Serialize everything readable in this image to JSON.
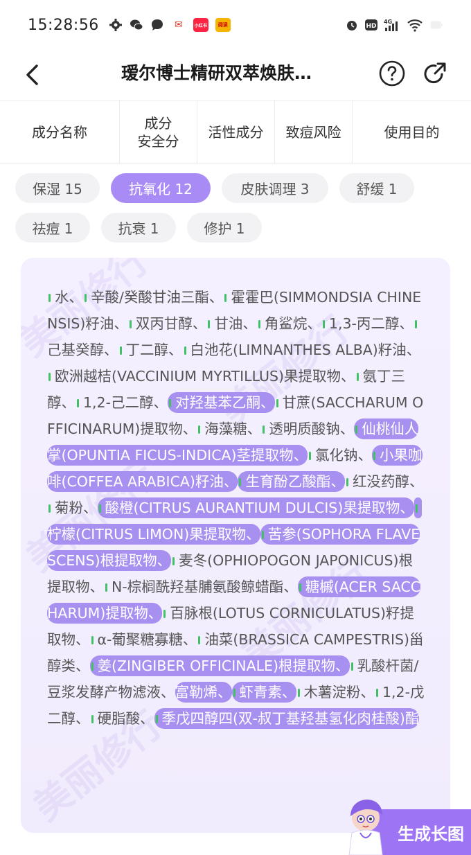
{
  "status": {
    "time": "15:28:56",
    "app_badge_1": "小红书",
    "app_badge_2": "阅读"
  },
  "nav": {
    "title": "瑷尔博士精研双萃焕肤…"
  },
  "columns": [
    {
      "label": "成分名称"
    },
    {
      "label": "成分\n安全分"
    },
    {
      "label": "活性成分"
    },
    {
      "label": "致痘风险"
    },
    {
      "label": "使用目的"
    }
  ],
  "chips": [
    {
      "label": "保湿 15",
      "active": false
    },
    {
      "label": "抗氧化 12",
      "active": true
    },
    {
      "label": "皮肤调理 3",
      "active": false
    },
    {
      "label": "舒缓 1",
      "active": false
    },
    {
      "label": "祛痘 1",
      "active": false
    },
    {
      "label": "抗衰 1",
      "active": false
    },
    {
      "label": "修护 1",
      "active": false
    }
  ],
  "watermark": "美丽修行",
  "ingredients": [
    {
      "name": "水",
      "hl": false
    },
    {
      "name": "辛酸/癸酸甘油三酯",
      "hl": false
    },
    {
      "name": "霍霍巴(SIMMONDSIA CHINENSIS)籽油",
      "hl": false
    },
    {
      "name": "双丙甘醇",
      "hl": false
    },
    {
      "name": "甘油",
      "hl": false
    },
    {
      "name": "角鲨烷",
      "hl": false
    },
    {
      "name": "1,3-丙二醇",
      "hl": false
    },
    {
      "name": "己基癸醇",
      "hl": false
    },
    {
      "name": "丁二醇",
      "hl": false
    },
    {
      "name": "白池花(LIMNANTHES ALBA)籽油",
      "hl": false
    },
    {
      "name": "欧洲越桔(VACCINIUM MYRTILLUS)果提取物",
      "hl": false
    },
    {
      "name": "氨丁三醇",
      "hl": false
    },
    {
      "name": "1,2-己二醇",
      "hl": false
    },
    {
      "name": "对羟基苯乙酮",
      "hl": true
    },
    {
      "name": "甘蔗(SACCHARUM OFFICINARUM)提取物",
      "hl": false
    },
    {
      "name": "海藻糖",
      "hl": false
    },
    {
      "name": "透明质酸钠",
      "hl": false
    },
    {
      "name": "仙桃仙人掌(OPUNTIA FICUS-INDICA)茎提取物",
      "hl": true
    },
    {
      "name": "氯化钠",
      "hl": false
    },
    {
      "name": "小果咖啡(COFFEA ARABICA)籽油",
      "hl": true
    },
    {
      "name": "生育酚乙酸酯",
      "hl": true
    },
    {
      "name": "红没药醇",
      "hl": false
    },
    {
      "name": "菊粉",
      "hl": false
    },
    {
      "name": "酸橙(CITRUS AURANTIUM DULCIS)果提取物",
      "hl": true
    },
    {
      "name": "柠檬(CITRUS LIMON)果提取物",
      "hl": true
    },
    {
      "name": "苦参(SOPHORA FLAVESCENS)根提取物",
      "hl": true
    },
    {
      "name": "麦冬(OPHIOPOGON JAPONICUS)根提取物",
      "hl": false
    },
    {
      "name": "N-棕榈酰羟基脯氨酸鲸蜡酯",
      "hl": false
    },
    {
      "name": "糖槭(ACER SACCHARUM)提取物",
      "hl": true
    },
    {
      "name": "百脉根(LOTUS CORNICULATUS)籽提取物",
      "hl": false
    },
    {
      "name": "α-葡聚糖寡糖",
      "hl": false
    },
    {
      "name": "油菜(BRASSICA CAMPESTRIS)甾醇类",
      "hl": false
    },
    {
      "name": "姜(ZINGIBER OFFICINALE)根提取物",
      "hl": true
    },
    {
      "name": "乳酸杆菌/豆浆发酵产物滤液",
      "hl": false
    },
    {
      "name": "富勒烯",
      "hl": true,
      "nodot": true
    },
    {
      "name": "虾青素",
      "hl": true
    },
    {
      "name": "木薯淀粉",
      "hl": false
    },
    {
      "name": "1,2-戊二醇",
      "hl": false
    },
    {
      "name": "硬脂酸",
      "hl": false
    },
    {
      "name": "季戊四醇四(双-叔丁基羟基氢化肉桂酸)酯",
      "hl": true
    }
  ],
  "separator": "、",
  "generate_button": {
    "label": "生成长图"
  }
}
